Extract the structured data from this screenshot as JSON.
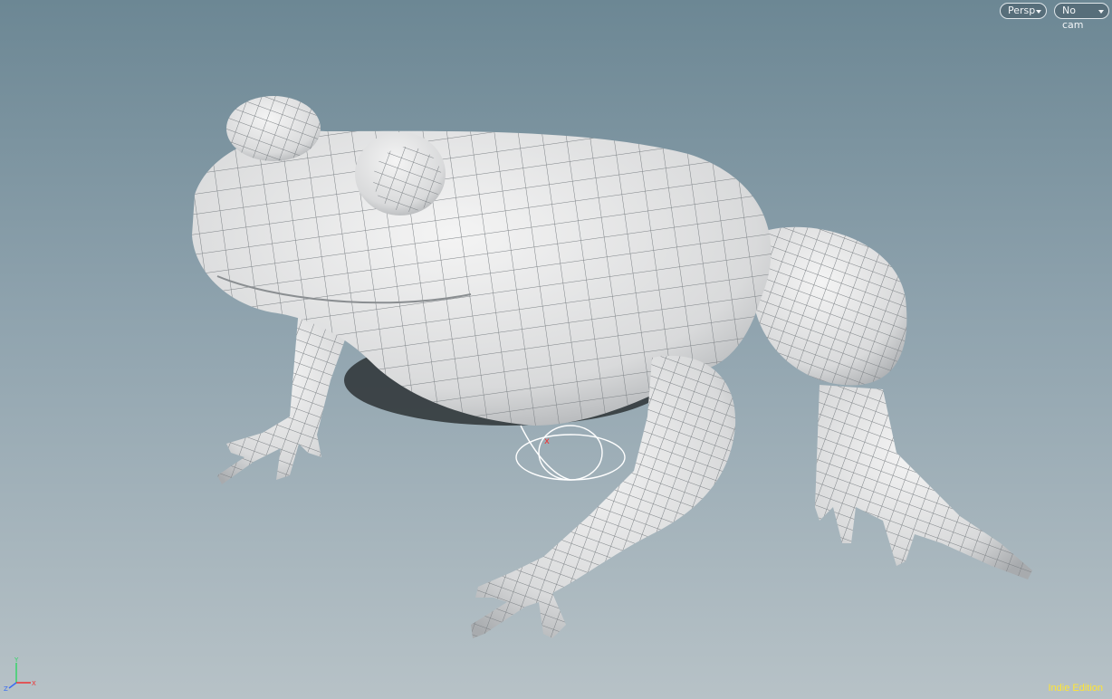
{
  "viewport": {
    "view_menu": {
      "label": "Persp"
    },
    "camera_menu": {
      "label": "No cam"
    },
    "edition_label": "Indie Edition",
    "axis": {
      "y": "Y",
      "x": "X",
      "z": "Z"
    },
    "colors": {
      "bg_top": "#6c8794",
      "bg_bottom": "#b7c2c7",
      "edition": "#ffe534"
    }
  }
}
